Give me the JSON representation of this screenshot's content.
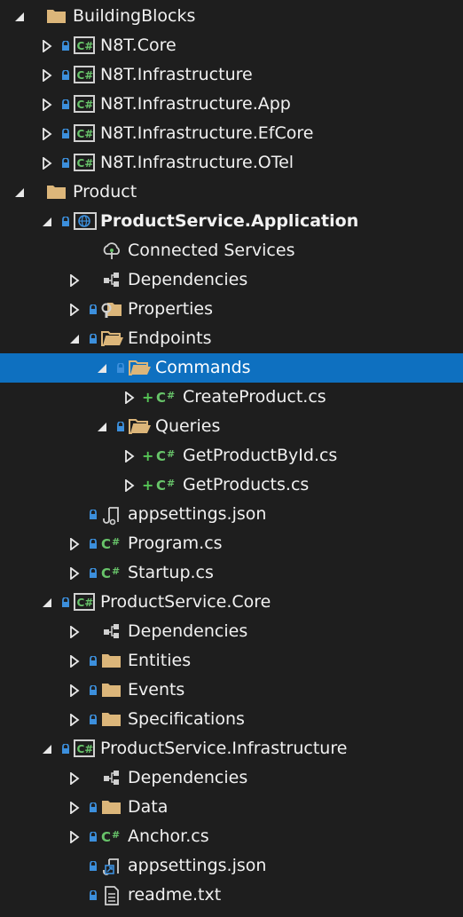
{
  "tree": [
    {
      "id": "buildingblocks",
      "label": "BuildingBlocks",
      "icon": "folder-icon",
      "expander": "expanded",
      "lock": false,
      "plus": false,
      "level": 0
    },
    {
      "id": "n8t-core",
      "label": "N8T.Core",
      "icon": "csharp-project-icon",
      "expander": "collapsed",
      "lock": true,
      "plus": false,
      "level": 1
    },
    {
      "id": "n8t-infrastructure",
      "label": "N8T.Infrastructure",
      "icon": "csharp-project-icon",
      "expander": "collapsed",
      "lock": true,
      "plus": false,
      "level": 1
    },
    {
      "id": "n8t-infrastructure-app",
      "label": "N8T.Infrastructure.App",
      "icon": "csharp-project-icon",
      "expander": "collapsed",
      "lock": true,
      "plus": false,
      "level": 1
    },
    {
      "id": "n8t-infrastructure-efcore",
      "label": "N8T.Infrastructure.EfCore",
      "icon": "csharp-project-icon",
      "expander": "collapsed",
      "lock": true,
      "plus": false,
      "level": 1
    },
    {
      "id": "n8t-infrastructure-otel",
      "label": "N8T.Infrastructure.OTel",
      "icon": "csharp-project-icon",
      "expander": "collapsed",
      "lock": true,
      "plus": false,
      "level": 1
    },
    {
      "id": "product",
      "label": "Product",
      "icon": "folder-icon",
      "expander": "expanded",
      "lock": false,
      "plus": false,
      "level": 0
    },
    {
      "id": "productservice-application",
      "label": "ProductService.Application",
      "icon": "web-project-icon",
      "expander": "expanded",
      "lock": true,
      "plus": false,
      "level": 1,
      "bold": true
    },
    {
      "id": "connected-services",
      "label": "Connected Services",
      "icon": "connected-services-icon",
      "expander": "none",
      "lock": false,
      "plus": false,
      "level": 2
    },
    {
      "id": "app-dependencies",
      "label": "Dependencies",
      "icon": "dependencies-icon",
      "expander": "collapsed",
      "lock": false,
      "plus": false,
      "level": 2
    },
    {
      "id": "properties",
      "label": "Properties",
      "icon": "properties-folder-icon",
      "expander": "collapsed",
      "lock": true,
      "plus": false,
      "level": 2
    },
    {
      "id": "endpoints",
      "label": "Endpoints",
      "icon": "folder-open-icon",
      "expander": "expanded",
      "lock": true,
      "plus": false,
      "level": 2
    },
    {
      "id": "commands",
      "label": "Commands",
      "icon": "folder-open-icon",
      "expander": "expanded",
      "lock": true,
      "plus": false,
      "level": 3,
      "selected": true
    },
    {
      "id": "createproduct",
      "label": "CreateProduct.cs",
      "icon": "csharp-file-icon",
      "expander": "collapsed",
      "lock": false,
      "plus": true,
      "level": 4
    },
    {
      "id": "queries",
      "label": "Queries",
      "icon": "folder-open-icon",
      "expander": "expanded",
      "lock": true,
      "plus": false,
      "level": 3
    },
    {
      "id": "getproductbyid",
      "label": "GetProductById.cs",
      "icon": "csharp-file-icon",
      "expander": "collapsed",
      "lock": false,
      "plus": true,
      "level": 4
    },
    {
      "id": "getproducts",
      "label": "GetProducts.cs",
      "icon": "csharp-file-icon",
      "expander": "collapsed",
      "lock": false,
      "plus": true,
      "level": 4
    },
    {
      "id": "app-appsettings",
      "label": "appsettings.json",
      "icon": "json-file-icon",
      "expander": "none",
      "lock": true,
      "plus": false,
      "level": 2
    },
    {
      "id": "program",
      "label": "Program.cs",
      "icon": "csharp-file-icon",
      "expander": "collapsed",
      "lock": true,
      "plus": false,
      "level": 2
    },
    {
      "id": "startup",
      "label": "Startup.cs",
      "icon": "csharp-file-icon",
      "expander": "collapsed",
      "lock": true,
      "plus": false,
      "level": 2
    },
    {
      "id": "productservice-core",
      "label": "ProductService.Core",
      "icon": "csharp-project-icon",
      "expander": "expanded",
      "lock": true,
      "plus": false,
      "level": 1
    },
    {
      "id": "core-dependencies",
      "label": "Dependencies",
      "icon": "dependencies-icon",
      "expander": "collapsed",
      "lock": false,
      "plus": false,
      "level": 2
    },
    {
      "id": "entities",
      "label": "Entities",
      "icon": "folder-icon",
      "expander": "collapsed",
      "lock": true,
      "plus": false,
      "level": 2
    },
    {
      "id": "events",
      "label": "Events",
      "icon": "folder-icon",
      "expander": "collapsed",
      "lock": true,
      "plus": false,
      "level": 2
    },
    {
      "id": "specifications",
      "label": "Specifications",
      "icon": "folder-icon",
      "expander": "collapsed",
      "lock": true,
      "plus": false,
      "level": 2
    },
    {
      "id": "productservice-infrastructure",
      "label": "ProductService.Infrastructure",
      "icon": "csharp-project-icon",
      "expander": "expanded",
      "lock": true,
      "plus": false,
      "level": 1
    },
    {
      "id": "infra-dependencies",
      "label": "Dependencies",
      "icon": "dependencies-icon",
      "expander": "collapsed",
      "lock": false,
      "plus": false,
      "level": 2
    },
    {
      "id": "data",
      "label": "Data",
      "icon": "folder-icon",
      "expander": "collapsed",
      "lock": true,
      "plus": false,
      "level": 2
    },
    {
      "id": "anchor",
      "label": "Anchor.cs",
      "icon": "csharp-file-icon",
      "expander": "collapsed",
      "lock": true,
      "plus": false,
      "level": 2
    },
    {
      "id": "infra-appsettings",
      "label": "appsettings.json",
      "icon": "json-link-file-icon",
      "expander": "none",
      "lock": true,
      "plus": false,
      "level": 2
    },
    {
      "id": "readme",
      "label": "readme.txt",
      "icon": "text-file-icon",
      "expander": "none",
      "lock": true,
      "plus": false,
      "level": 2
    }
  ],
  "colors": {
    "background": "#1e1e1e",
    "selection": "#0e70c0",
    "folder": "#dcb67a",
    "csharp": "#68c46a",
    "lock": "#3c8fdc",
    "text": "#f1f1f1"
  }
}
